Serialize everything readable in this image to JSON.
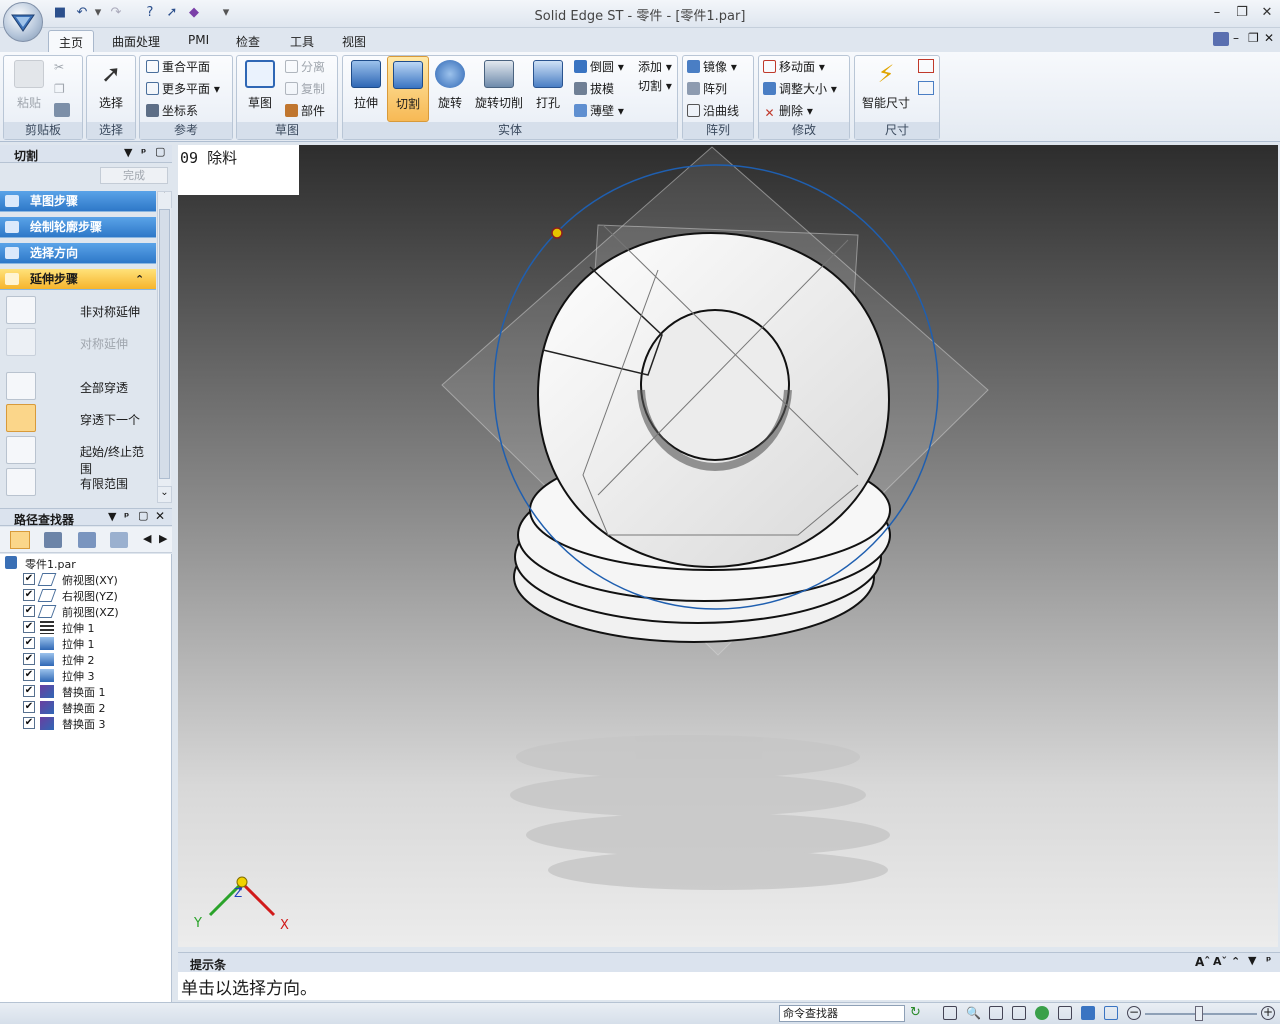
{
  "window": {
    "title": "Solid Edge ST - 零件 - [零件1.par]",
    "minimize": "–",
    "restore": "❐",
    "close": "✕"
  },
  "qat": {
    "dropdown": "▾"
  },
  "tabs": [
    "主页",
    "曲面处理",
    "PMI",
    "检查",
    "工具",
    "视图"
  ],
  "ribbon": {
    "clipboard": {
      "label": "剪贴板",
      "paste": "粘贴"
    },
    "select": {
      "label": "选择",
      "select": "选择"
    },
    "reference": {
      "label": "参考",
      "coincident_plane": "重合平面",
      "more_planes": "更多平面",
      "coord_system": "坐标系"
    },
    "sketch": {
      "label": "草图",
      "sketch": "草图",
      "separate": "分离",
      "copy": "复制",
      "part": "部件"
    },
    "solids": {
      "label": "实体",
      "extrude": "拉伸",
      "cut": "切割",
      "revolve": "旋转",
      "revolve_cut": "旋转切削",
      "hole": "打孔",
      "round": "倒圆",
      "draft": "拔模",
      "thin_wall": "薄壁",
      "add": "添加",
      "cut_small": "切割"
    },
    "pattern": {
      "label": "阵列",
      "mirror": "镜像",
      "pattern": "阵列",
      "along_curve": "沿曲线"
    },
    "modify": {
      "label": "修改",
      "move_face": "移动面",
      "resize": "调整大小",
      "delete": "删除"
    },
    "dimension": {
      "label": "尺寸",
      "smart_dimension": "智能尺寸"
    }
  },
  "cut_panel": {
    "title": "切割",
    "finish": "完成",
    "steps": [
      "草图步骤",
      "绘制轮廓步骤",
      "选择方向",
      "延伸步骤"
    ],
    "options": [
      {
        "label": "非对称延伸",
        "enabled": true
      },
      {
        "label": "对称延伸",
        "enabled": false
      },
      {
        "label": "全部穿透",
        "enabled": true
      },
      {
        "label": "穿透下一个",
        "enabled": true,
        "selected": true
      },
      {
        "label": "起始/终止范围",
        "enabled": true
      },
      {
        "label": "有限范围",
        "enabled": true
      }
    ]
  },
  "pathfinder": {
    "title": "路径查找器",
    "root": "零件1.par",
    "items": [
      "俯视图(XY)",
      "右视图(YZ)",
      "前视图(XZ)",
      "拉伸 1",
      "拉伸 1",
      "拉伸 2",
      "拉伸 3",
      "替换面 1",
      "替换面 2",
      "替换面 3"
    ]
  },
  "viewport": {
    "step_label": "09 除料",
    "axes": {
      "x": "X",
      "y": "Y",
      "z": "Z"
    }
  },
  "prompt_bar": {
    "title": "提示条",
    "text": "单击以选择方向。"
  },
  "status_bar": {
    "command_finder": "命令查找器"
  },
  "colors": {
    "accent_active": "#f6b42c",
    "step_bar": "#2e78c8",
    "circle_outline": "#1f5fb0"
  }
}
